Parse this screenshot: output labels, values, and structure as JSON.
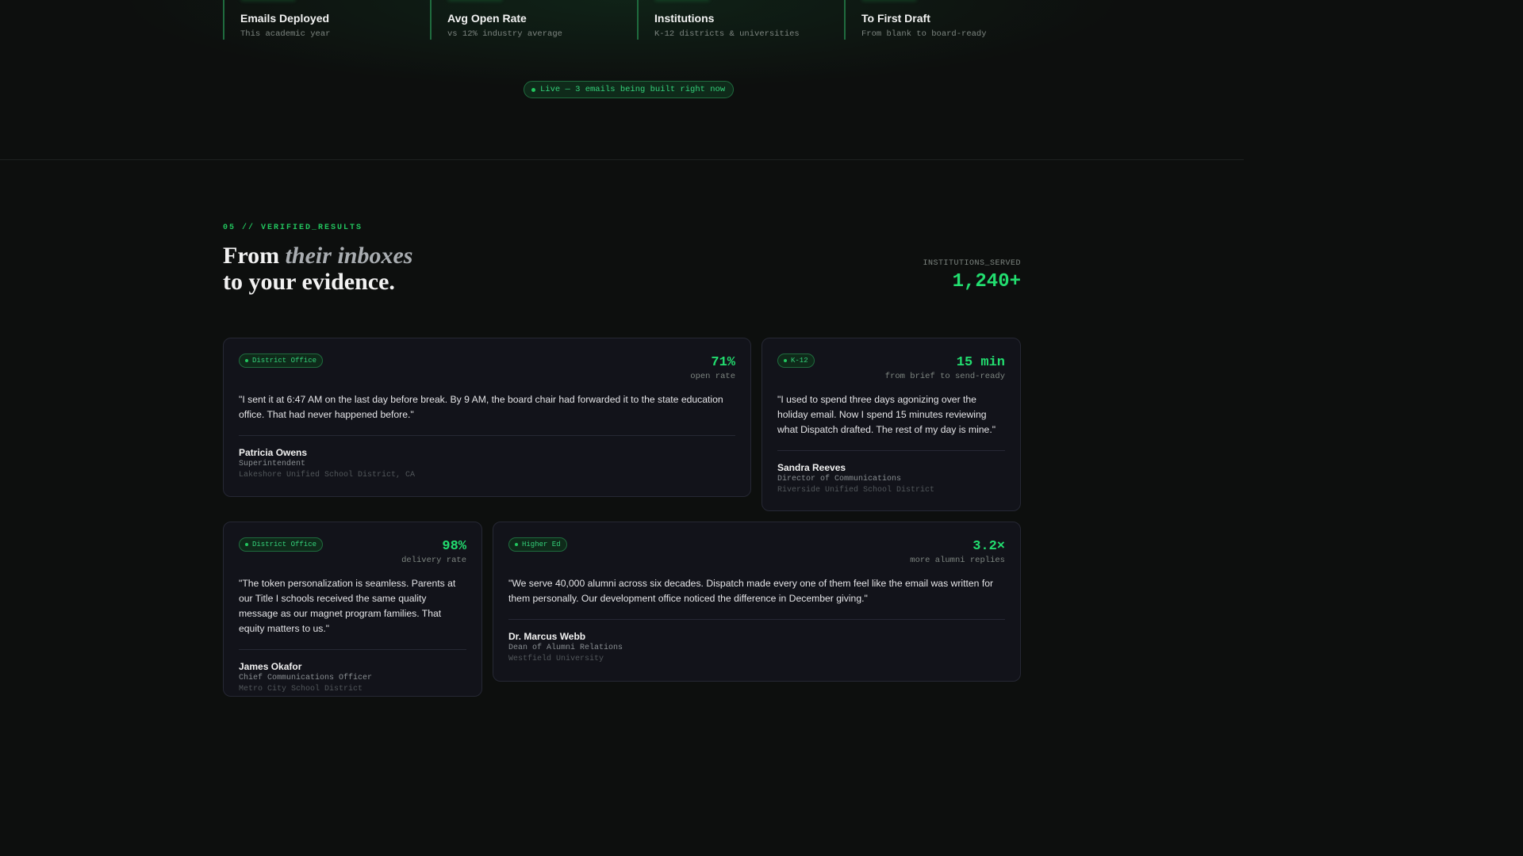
{
  "stats": [
    {
      "label": "Emails Deployed",
      "sub": "This academic year"
    },
    {
      "label": "Avg Open Rate",
      "sub": "vs 12% industry average"
    },
    {
      "label": "Institutions",
      "sub": "K-12 districts & universities"
    },
    {
      "label": "To First Draft",
      "sub": "From blank to board-ready"
    }
  ],
  "live_badge": "Live — 3 emails being built right now",
  "section": {
    "label": "05 // VERIFIED_RESULTS",
    "headline_prefix": "From ",
    "headline_em": "their inboxes",
    "headline_line2": "to your evidence.",
    "served_label": "INSTITUTIONS_SERVED",
    "served_value": "1,240+"
  },
  "testimonials": [
    {
      "tag": "District Office",
      "metric_value": "71%",
      "metric_label": "open rate",
      "quote": "\"I sent it at 6:47 AM on the last day before break. By 9 AM, the board chair had forwarded it to the state education office. That had never happened before.\"",
      "name": "Patricia Owens",
      "role": "Superintendent",
      "org": "Lakeshore Unified School District, CA"
    },
    {
      "tag": "K-12",
      "metric_value": "15 min",
      "metric_label": "from brief to send-ready",
      "quote": "\"I used to spend three days agonizing over the holiday email. Now I spend 15 minutes reviewing what Dispatch drafted. The rest of my day is mine.\"",
      "name": "Sandra Reeves",
      "role": "Director of Communications",
      "org": "Riverside Unified School District"
    },
    {
      "tag": "District Office",
      "metric_value": "98%",
      "metric_label": "delivery rate",
      "quote": "\"The token personalization is seamless. Parents at our Title I schools received the same quality message as our magnet program families. That equity matters to us.\"",
      "name": "James Okafor",
      "role": "Chief Communications Officer",
      "org": "Metro City School District"
    },
    {
      "tag": "Higher Ed",
      "metric_value": "3.2×",
      "metric_label": "more alumni replies",
      "quote": "\"We serve 40,000 alumni across six decades. Dispatch made every one of them feel like the email was written for them personally. Our development office noticed the difference in December giving.\"",
      "name": "Dr. Marcus Webb",
      "role": "Dean of Alumni Relations",
      "org": "Westfield University"
    }
  ]
}
